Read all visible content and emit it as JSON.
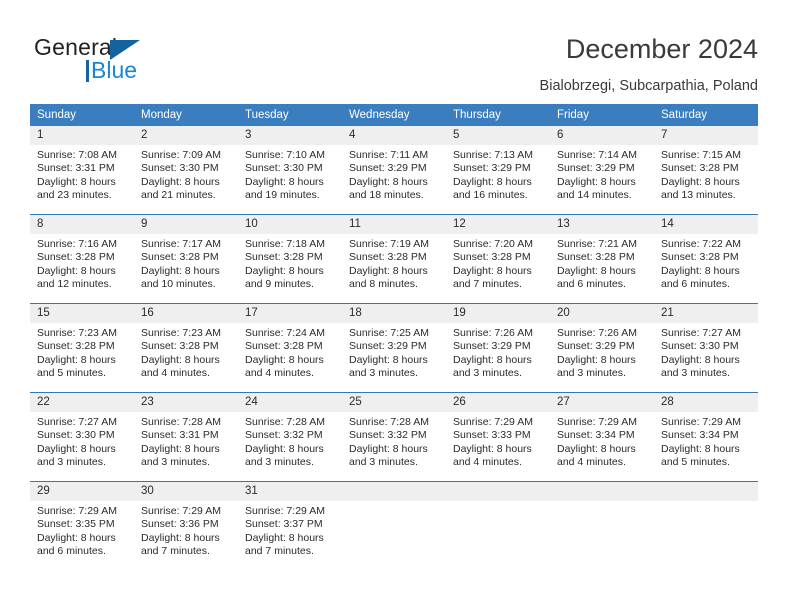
{
  "logo": {
    "word_one": "General",
    "word_two": "Blue",
    "triangle_color": "#1263a0",
    "blue_color": "#1a85d6"
  },
  "header": {
    "title": "December 2024",
    "subtitle": "Bialobrzegi, Subcarpathia, Poland"
  },
  "colors": {
    "header_bar": "#3b7ebf",
    "row_separator": "#2f79b5",
    "daynum_strip": "#efefef",
    "text": "#2b2b2b"
  },
  "calendar": {
    "weekday_headers": [
      "Sunday",
      "Monday",
      "Tuesday",
      "Wednesday",
      "Thursday",
      "Friday",
      "Saturday"
    ],
    "weeks": [
      [
        {
          "day": "1",
          "sunrise": "Sunrise: 7:08 AM",
          "sunset": "Sunset: 3:31 PM",
          "daylight_line1": "Daylight: 8 hours",
          "daylight_line2": "and 23 minutes."
        },
        {
          "day": "2",
          "sunrise": "Sunrise: 7:09 AM",
          "sunset": "Sunset: 3:30 PM",
          "daylight_line1": "Daylight: 8 hours",
          "daylight_line2": "and 21 minutes."
        },
        {
          "day": "3",
          "sunrise": "Sunrise: 7:10 AM",
          "sunset": "Sunset: 3:30 PM",
          "daylight_line1": "Daylight: 8 hours",
          "daylight_line2": "and 19 minutes."
        },
        {
          "day": "4",
          "sunrise": "Sunrise: 7:11 AM",
          "sunset": "Sunset: 3:29 PM",
          "daylight_line1": "Daylight: 8 hours",
          "daylight_line2": "and 18 minutes."
        },
        {
          "day": "5",
          "sunrise": "Sunrise: 7:13 AM",
          "sunset": "Sunset: 3:29 PM",
          "daylight_line1": "Daylight: 8 hours",
          "daylight_line2": "and 16 minutes."
        },
        {
          "day": "6",
          "sunrise": "Sunrise: 7:14 AM",
          "sunset": "Sunset: 3:29 PM",
          "daylight_line1": "Daylight: 8 hours",
          "daylight_line2": "and 14 minutes."
        },
        {
          "day": "7",
          "sunrise": "Sunrise: 7:15 AM",
          "sunset": "Sunset: 3:28 PM",
          "daylight_line1": "Daylight: 8 hours",
          "daylight_line2": "and 13 minutes."
        }
      ],
      [
        {
          "day": "8",
          "sunrise": "Sunrise: 7:16 AM",
          "sunset": "Sunset: 3:28 PM",
          "daylight_line1": "Daylight: 8 hours",
          "daylight_line2": "and 12 minutes."
        },
        {
          "day": "9",
          "sunrise": "Sunrise: 7:17 AM",
          "sunset": "Sunset: 3:28 PM",
          "daylight_line1": "Daylight: 8 hours",
          "daylight_line2": "and 10 minutes."
        },
        {
          "day": "10",
          "sunrise": "Sunrise: 7:18 AM",
          "sunset": "Sunset: 3:28 PM",
          "daylight_line1": "Daylight: 8 hours",
          "daylight_line2": "and 9 minutes."
        },
        {
          "day": "11",
          "sunrise": "Sunrise: 7:19 AM",
          "sunset": "Sunset: 3:28 PM",
          "daylight_line1": "Daylight: 8 hours",
          "daylight_line2": "and 8 minutes."
        },
        {
          "day": "12",
          "sunrise": "Sunrise: 7:20 AM",
          "sunset": "Sunset: 3:28 PM",
          "daylight_line1": "Daylight: 8 hours",
          "daylight_line2": "and 7 minutes."
        },
        {
          "day": "13",
          "sunrise": "Sunrise: 7:21 AM",
          "sunset": "Sunset: 3:28 PM",
          "daylight_line1": "Daylight: 8 hours",
          "daylight_line2": "and 6 minutes."
        },
        {
          "day": "14",
          "sunrise": "Sunrise: 7:22 AM",
          "sunset": "Sunset: 3:28 PM",
          "daylight_line1": "Daylight: 8 hours",
          "daylight_line2": "and 6 minutes."
        }
      ],
      [
        {
          "day": "15",
          "sunrise": "Sunrise: 7:23 AM",
          "sunset": "Sunset: 3:28 PM",
          "daylight_line1": "Daylight: 8 hours",
          "daylight_line2": "and 5 minutes."
        },
        {
          "day": "16",
          "sunrise": "Sunrise: 7:23 AM",
          "sunset": "Sunset: 3:28 PM",
          "daylight_line1": "Daylight: 8 hours",
          "daylight_line2": "and 4 minutes."
        },
        {
          "day": "17",
          "sunrise": "Sunrise: 7:24 AM",
          "sunset": "Sunset: 3:28 PM",
          "daylight_line1": "Daylight: 8 hours",
          "daylight_line2": "and 4 minutes."
        },
        {
          "day": "18",
          "sunrise": "Sunrise: 7:25 AM",
          "sunset": "Sunset: 3:29 PM",
          "daylight_line1": "Daylight: 8 hours",
          "daylight_line2": "and 3 minutes."
        },
        {
          "day": "19",
          "sunrise": "Sunrise: 7:26 AM",
          "sunset": "Sunset: 3:29 PM",
          "daylight_line1": "Daylight: 8 hours",
          "daylight_line2": "and 3 minutes."
        },
        {
          "day": "20",
          "sunrise": "Sunrise: 7:26 AM",
          "sunset": "Sunset: 3:29 PM",
          "daylight_line1": "Daylight: 8 hours",
          "daylight_line2": "and 3 minutes."
        },
        {
          "day": "21",
          "sunrise": "Sunrise: 7:27 AM",
          "sunset": "Sunset: 3:30 PM",
          "daylight_line1": "Daylight: 8 hours",
          "daylight_line2": "and 3 minutes."
        }
      ],
      [
        {
          "day": "22",
          "sunrise": "Sunrise: 7:27 AM",
          "sunset": "Sunset: 3:30 PM",
          "daylight_line1": "Daylight: 8 hours",
          "daylight_line2": "and 3 minutes."
        },
        {
          "day": "23",
          "sunrise": "Sunrise: 7:28 AM",
          "sunset": "Sunset: 3:31 PM",
          "daylight_line1": "Daylight: 8 hours",
          "daylight_line2": "and 3 minutes."
        },
        {
          "day": "24",
          "sunrise": "Sunrise: 7:28 AM",
          "sunset": "Sunset: 3:32 PM",
          "daylight_line1": "Daylight: 8 hours",
          "daylight_line2": "and 3 minutes."
        },
        {
          "day": "25",
          "sunrise": "Sunrise: 7:28 AM",
          "sunset": "Sunset: 3:32 PM",
          "daylight_line1": "Daylight: 8 hours",
          "daylight_line2": "and 3 minutes."
        },
        {
          "day": "26",
          "sunrise": "Sunrise: 7:29 AM",
          "sunset": "Sunset: 3:33 PM",
          "daylight_line1": "Daylight: 8 hours",
          "daylight_line2": "and 4 minutes."
        },
        {
          "day": "27",
          "sunrise": "Sunrise: 7:29 AM",
          "sunset": "Sunset: 3:34 PM",
          "daylight_line1": "Daylight: 8 hours",
          "daylight_line2": "and 4 minutes."
        },
        {
          "day": "28",
          "sunrise": "Sunrise: 7:29 AM",
          "sunset": "Sunset: 3:34 PM",
          "daylight_line1": "Daylight: 8 hours",
          "daylight_line2": "and 5 minutes."
        }
      ],
      [
        {
          "day": "29",
          "sunrise": "Sunrise: 7:29 AM",
          "sunset": "Sunset: 3:35 PM",
          "daylight_line1": "Daylight: 8 hours",
          "daylight_line2": "and 6 minutes."
        },
        {
          "day": "30",
          "sunrise": "Sunrise: 7:29 AM",
          "sunset": "Sunset: 3:36 PM",
          "daylight_line1": "Daylight: 8 hours",
          "daylight_line2": "and 7 minutes."
        },
        {
          "day": "31",
          "sunrise": "Sunrise: 7:29 AM",
          "sunset": "Sunset: 3:37 PM",
          "daylight_line1": "Daylight: 8 hours",
          "daylight_line2": "and 7 minutes."
        },
        {
          "day": "",
          "sunrise": "",
          "sunset": "",
          "daylight_line1": "",
          "daylight_line2": ""
        },
        {
          "day": "",
          "sunrise": "",
          "sunset": "",
          "daylight_line1": "",
          "daylight_line2": ""
        },
        {
          "day": "",
          "sunrise": "",
          "sunset": "",
          "daylight_line1": "",
          "daylight_line2": ""
        },
        {
          "day": "",
          "sunrise": "",
          "sunset": "",
          "daylight_line1": "",
          "daylight_line2": ""
        }
      ]
    ]
  }
}
